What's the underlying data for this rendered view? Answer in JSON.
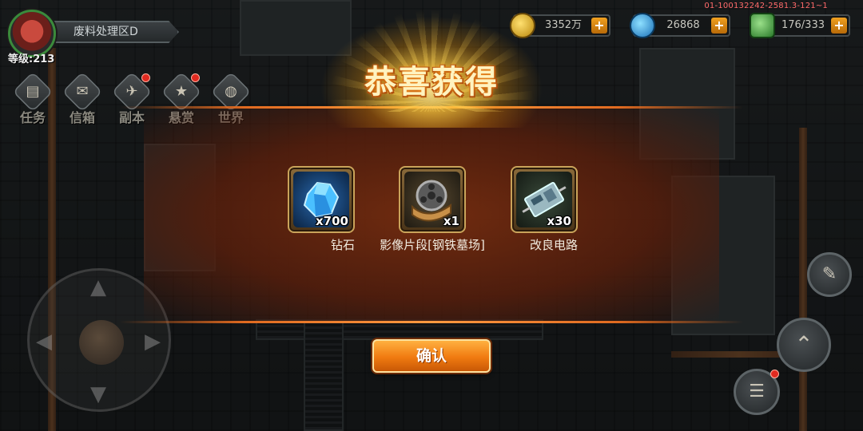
{
  "hud": {
    "area_name": "废料处理区D",
    "level": "等级:213",
    "version": "01-100132242-2581.3-121~1",
    "menu": [
      {
        "label": "任务",
        "icon": "scroll-icon",
        "badge": false
      },
      {
        "label": "信箱",
        "icon": "mailbox-icon",
        "badge": false
      },
      {
        "label": "副本",
        "icon": "wings-emblem-icon",
        "badge": true
      },
      {
        "label": "悬赏",
        "icon": "star-badge-icon",
        "badge": true
      },
      {
        "label": "世界",
        "icon": "globe-icon",
        "badge": false
      }
    ],
    "resources": [
      {
        "value": "3352万",
        "icon": "gold-coin-icon",
        "color": "#e0b020"
      },
      {
        "value": "26868",
        "icon": "blue-gem-icon",
        "color": "#2a9ae0"
      },
      {
        "value": "176/333",
        "icon": "green-energy-icon",
        "color": "#3aa03a"
      }
    ],
    "plus_label": "+"
  },
  "reward": {
    "title": "恭喜获得",
    "items": [
      {
        "name": "钻石",
        "qty": "x700",
        "icon": "diamond-icon"
      },
      {
        "name": "影像片段[钢铁墓场]",
        "qty": "x1",
        "icon": "film-reel-icon"
      },
      {
        "name": "改良电路",
        "qty": "x30",
        "icon": "circuit-board-icon"
      }
    ],
    "confirm_label": "确认"
  },
  "controls": {
    "joystick_arrows": [
      "▲",
      "▼",
      "◀",
      "▶"
    ]
  },
  "colors": {
    "accent_orange": "#f07a10",
    "panel_brown": "#5a2210",
    "title_gold": "#fff3c0",
    "badge_red": "#e02a20"
  }
}
